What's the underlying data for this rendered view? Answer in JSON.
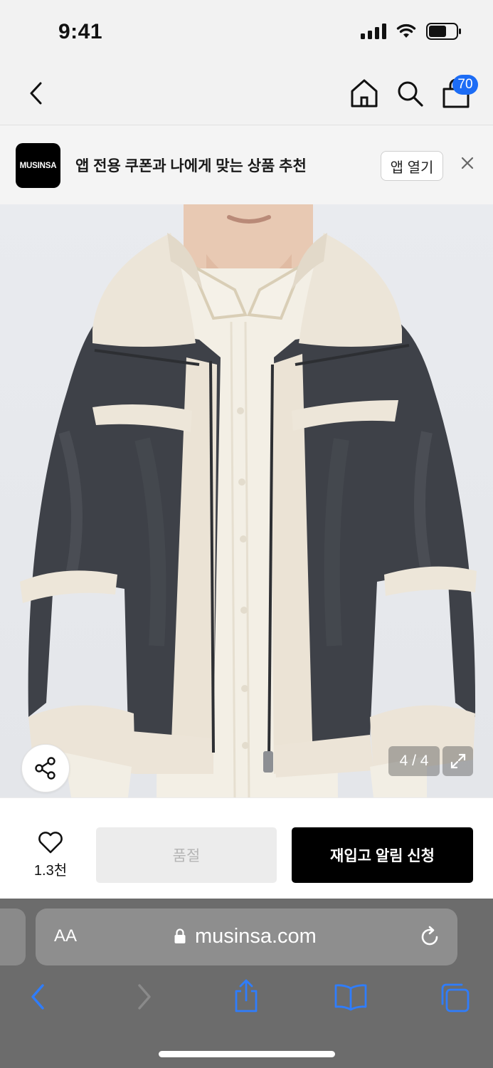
{
  "status_bar": {
    "time": "9:41"
  },
  "nav": {
    "back_icon": "chevron-left-icon",
    "home_icon": "home-icon",
    "search_icon": "search-icon",
    "cart_icon": "shopping-bag-icon",
    "cart_count": "70",
    "badge_color": "#1c6cf5"
  },
  "app_banner": {
    "logo_text": "MUSINSA",
    "message": "앱 전용 쿠폰과 나에게 맞는 상품 추천",
    "open_label": "앱 열기",
    "close_icon": "close-icon"
  },
  "gallery": {
    "counter": "4 / 4",
    "share_icon": "share-icon",
    "expand_icon": "expand-icon"
  },
  "purchase": {
    "like_icon": "heart-icon",
    "like_count": "1.3천",
    "soldout_label": "품절",
    "restock_label": "재입고 알림 신청"
  },
  "browser": {
    "text_size_label": "AA",
    "url": "musinsa.com",
    "lock_icon": "lock-icon",
    "reload_icon": "reload-icon",
    "toolbar": {
      "back_icon": "back-arrow-icon",
      "forward_icon": "forward-arrow-icon",
      "share_icon": "share-upload-icon",
      "bookmarks_icon": "book-icon",
      "tabs_icon": "tabs-icon",
      "accent": "#2f7dfc"
    }
  }
}
